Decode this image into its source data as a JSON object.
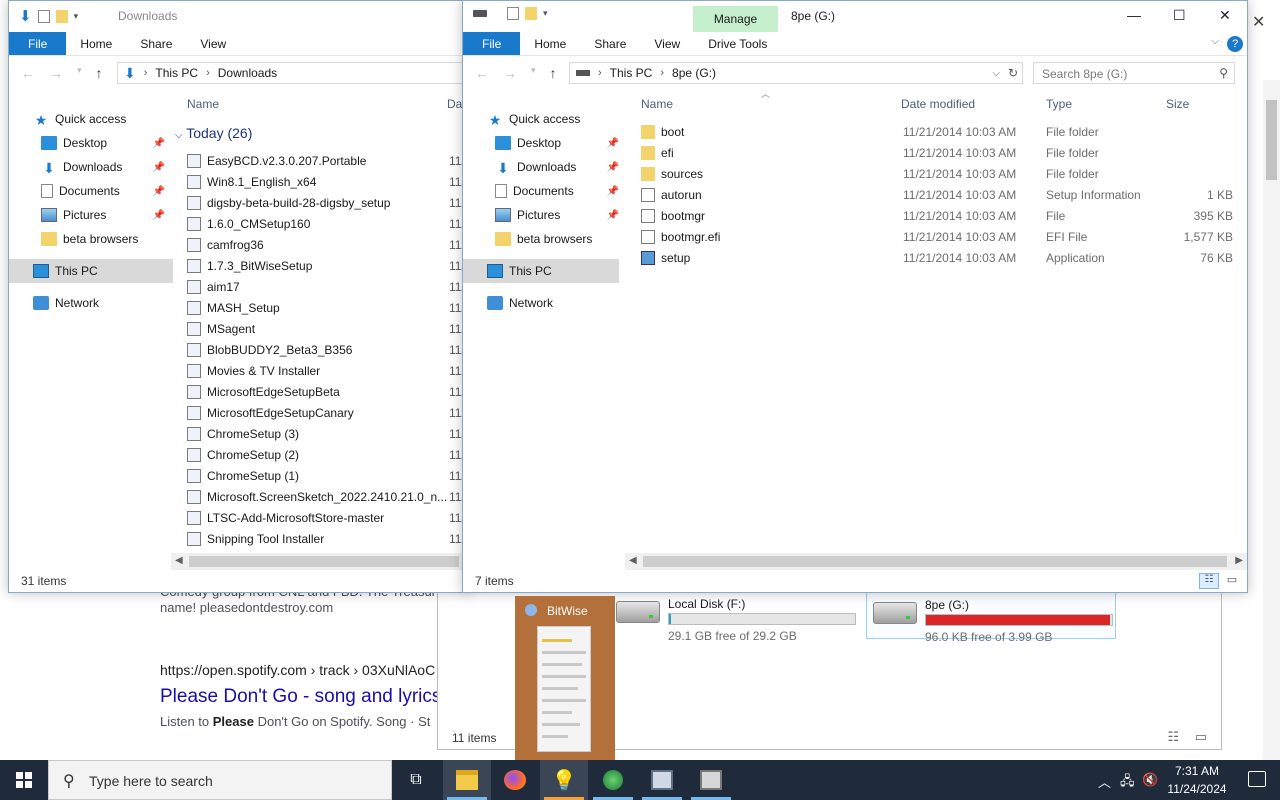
{
  "browser": {
    "snippet": "Comedy group from CNL and FBD. The Treasur",
    "snippet2": "name! pleasedontdestroy.com",
    "url": "https://open.spotify.com  › track › 03XuNlAoC",
    "link": "Please Don't Go - song and lyrics",
    "desc_pre": "Listen to ",
    "desc_bold": "Please",
    "desc_post": " Don't Go on Spotify. Song · St"
  },
  "pc_window": {
    "drives": [
      {
        "name": "Local Disk (F:)",
        "free": "29.1 GB free of 29.2 GB",
        "used_fraction": 0.01
      },
      {
        "name": "8pe (G:)",
        "free": "96.0 KB free of 3.99 GB",
        "used_fraction": 0.99
      }
    ],
    "status": "11 items"
  },
  "downloads": {
    "title": "Downloads",
    "tabs": [
      "File",
      "Home",
      "Share",
      "View"
    ],
    "address": [
      "This PC",
      "Downloads"
    ],
    "column_name": "Name",
    "column_date": "Dat",
    "group": "Today (26)",
    "files": [
      "EasyBCD.v2.3.0.207.Portable",
      "Win8.1_English_x64",
      "digsby-beta-build-28-digsby_setup",
      "1.6.0_CMSetup160",
      "camfrog36",
      "1.7.3_BitWiseSetup",
      "aim17",
      "MASH_Setup",
      "MSagent",
      "BlobBUDDY2_Beta3_B356",
      "Movies & TV Installer",
      "MicrosoftEdgeSetupBeta",
      "MicrosoftEdgeSetupCanary",
      "ChromeSetup (3)",
      "ChromeSetup (2)",
      "ChromeSetup (1)",
      "Microsoft.ScreenSketch_2022.2410.21.0_n...",
      "LTSC-Add-MicrosoftStore-master",
      "Snipping Tool Installer"
    ],
    "date_trunc": "11/",
    "status": "31 items"
  },
  "nav": {
    "quick_access": "Quick access",
    "desktop": "Desktop",
    "downloads": "Downloads",
    "documents": "Documents",
    "pictures": "Pictures",
    "beta": "beta browsers",
    "this_pc": "This PC",
    "network": "Network"
  },
  "g_window": {
    "title": "8pe (G:)",
    "manage": "Manage",
    "tabs": [
      "File",
      "Home",
      "Share",
      "View",
      "Drive Tools"
    ],
    "address": [
      "This PC",
      "8pe (G:)"
    ],
    "search_placeholder": "Search 8pe (G:)",
    "columns": {
      "name": "Name",
      "date": "Date modified",
      "type": "Type",
      "size": "Size"
    },
    "rows": [
      {
        "name": "boot",
        "date": "11/21/2014 10:03 AM",
        "type": "File folder",
        "size": "",
        "icon": "folder"
      },
      {
        "name": "efi",
        "date": "11/21/2014 10:03 AM",
        "type": "File folder",
        "size": "",
        "icon": "folder"
      },
      {
        "name": "sources",
        "date": "11/21/2014 10:03 AM",
        "type": "File folder",
        "size": "",
        "icon": "folder"
      },
      {
        "name": "autorun",
        "date": "11/21/2014 10:03 AM",
        "type": "Setup Information",
        "size": "1 KB",
        "icon": "doc"
      },
      {
        "name": "bootmgr",
        "date": "11/21/2014 10:03 AM",
        "type": "File",
        "size": "395 KB",
        "icon": "doc"
      },
      {
        "name": "bootmgr.efi",
        "date": "11/21/2014 10:03 AM",
        "type": "EFI File",
        "size": "1,577 KB",
        "icon": "doc"
      },
      {
        "name": "setup",
        "date": "11/21/2014 10:03 AM",
        "type": "Application",
        "size": "76 KB",
        "icon": "app"
      }
    ],
    "status": "7 items"
  },
  "thumbnail": {
    "title": "BitWise"
  },
  "taskbar": {
    "search_placeholder": "Type here to search",
    "time": "7:31 AM",
    "date": "11/24/2024"
  }
}
